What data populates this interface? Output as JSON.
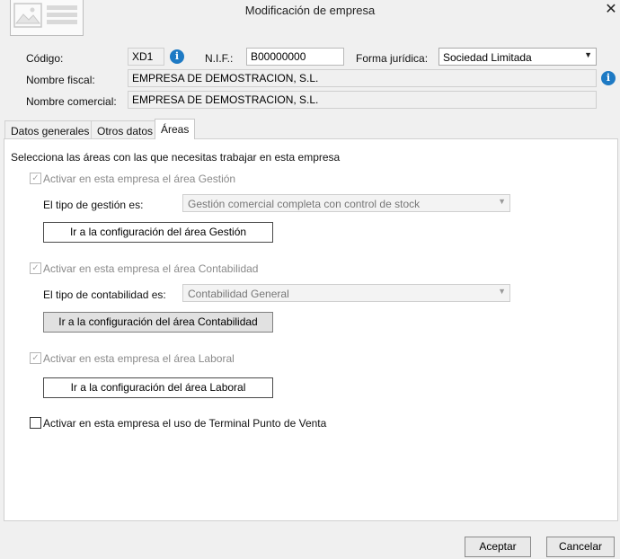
{
  "window": {
    "title": "Modificación de empresa",
    "close_glyph": "✕"
  },
  "header": {
    "codigo_label": "Código:",
    "codigo_value": "XD1",
    "nif_label": "N.I.F.:",
    "nif_value": "B00000000",
    "forma_label": "Forma jurídica:",
    "forma_value": "Sociedad Limitada",
    "fiscal_label": "Nombre fiscal:",
    "fiscal_value": "EMPRESA DE DEMOSTRACION, S.L.",
    "comercial_label": "Nombre comercial:",
    "comercial_value": "EMPRESA DE DEMOSTRACION, S.L.",
    "info_glyph": "i"
  },
  "tabs": [
    {
      "label": "Datos generales"
    },
    {
      "label": "Otros datos"
    },
    {
      "label": "Áreas"
    }
  ],
  "areas": {
    "intro": "Selecciona las áreas con las que necesitas trabajar en esta empresa",
    "check_glyph": "✓",
    "gestion": {
      "check_label": "Activar en esta empresa el área Gestión",
      "type_label": "El tipo de gestión es:",
      "type_value": "Gestión comercial completa con control de stock",
      "button": "Ir a la configuración del área Gestión"
    },
    "contabilidad": {
      "check_label": "Activar en esta empresa el área Contabilidad",
      "type_label": "El tipo de contabilidad es:",
      "type_value": "Contabilidad General",
      "button": "Ir a la configuración del área Contabilidad"
    },
    "laboral": {
      "check_label": "Activar en esta empresa el área Laboral",
      "button": "Ir a la configuración del área Laboral"
    },
    "tpv": {
      "check_label": "Activar en esta empresa el uso de Terminal Punto de Venta"
    }
  },
  "footer": {
    "accept": "Aceptar",
    "cancel": "Cancelar"
  }
}
